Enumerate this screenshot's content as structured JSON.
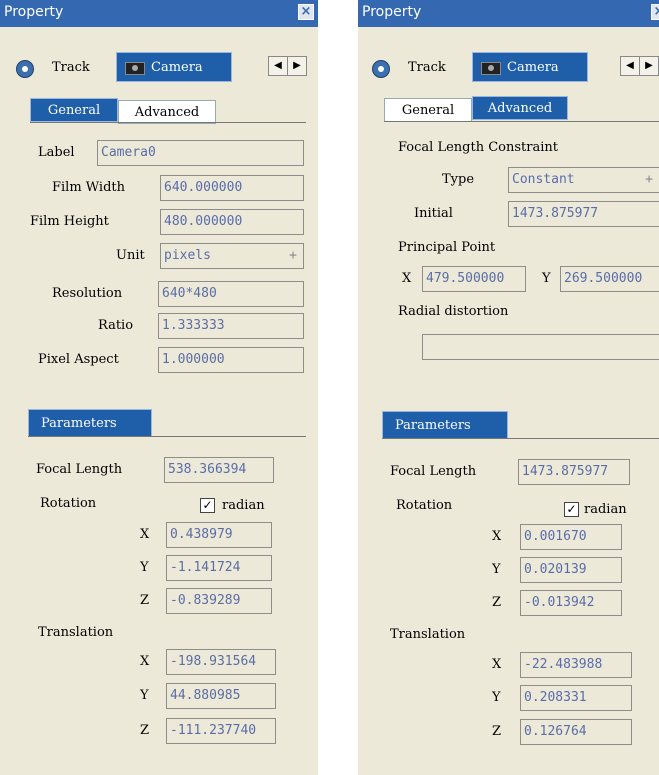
{
  "left": {
    "window_title": "Property",
    "tabs": {
      "track": "Track",
      "camera": "Camera"
    },
    "subtabs": {
      "general": "General",
      "advanced": "Advanced"
    },
    "general": {
      "label": {
        "label": "Label",
        "value": "Camera0"
      },
      "film_width": {
        "label": "Film Width",
        "value": "640.000000"
      },
      "film_height": {
        "label": "Film Height",
        "value": "480.000000"
      },
      "unit": {
        "label": "Unit",
        "value": "pixels"
      },
      "resolution": {
        "label": "Resolution",
        "value": "640*480"
      },
      "ratio": {
        "label": "Ratio",
        "value": "1.333333"
      },
      "pixel_aspect": {
        "label": "Pixel Aspect",
        "value": "1.000000"
      }
    },
    "parameters": {
      "header": "Parameters",
      "focal_length": {
        "label": "Focal Length",
        "value": "538.366394"
      },
      "rotation": {
        "label": "Rotation",
        "radian_label": "radian",
        "x": "0.438979",
        "y": "-1.141724",
        "z": "-0.839289"
      },
      "translation": {
        "label": "Translation",
        "x": "-198.931564",
        "y": "44.880985",
        "z": "-111.237740"
      }
    }
  },
  "right": {
    "window_title": "Property",
    "tabs": {
      "track": "Track",
      "camera": "Camera"
    },
    "subtabs": {
      "general": "General",
      "advanced": "Advanced"
    },
    "advanced": {
      "focal_constraint_heading": "Focal Length Constraint",
      "type": {
        "label": "Type",
        "value": "Constant"
      },
      "initial": {
        "label": "Initial",
        "value": "1473.875977"
      },
      "principal_point_heading": "Principal Point",
      "pp_x": {
        "label": "X",
        "value": "479.500000"
      },
      "pp_y": {
        "label": "Y",
        "value": "269.500000"
      },
      "radial_heading": "Radial distortion",
      "radial_value": ""
    },
    "parameters": {
      "header": "Parameters",
      "focal_length": {
        "label": "Focal Length",
        "value": "1473.875977"
      },
      "rotation": {
        "label": "Rotation",
        "radian_label": "radian",
        "x": "0.001670",
        "y": "0.020139",
        "z": "-0.013942"
      },
      "translation": {
        "label": "Translation",
        "x": "-22.483988",
        "y": "0.208331",
        "z": "0.126764"
      }
    }
  },
  "axis": {
    "x": "X",
    "y": "Y",
    "z": "Z"
  },
  "icons": {
    "close": "close-icon",
    "track": "film-reel-icon",
    "camera": "camera-icon",
    "scroll_left": "arrow-left-icon",
    "scroll_right": "arrow-right-icon",
    "checkbox": "checkmark-icon",
    "plus": "plus-icon"
  },
  "colors": {
    "titlebar": "#3468b0",
    "active_tab": "#1f5ea8",
    "panel_bg": "#ece9d8",
    "field_text": "#5a6da8"
  }
}
